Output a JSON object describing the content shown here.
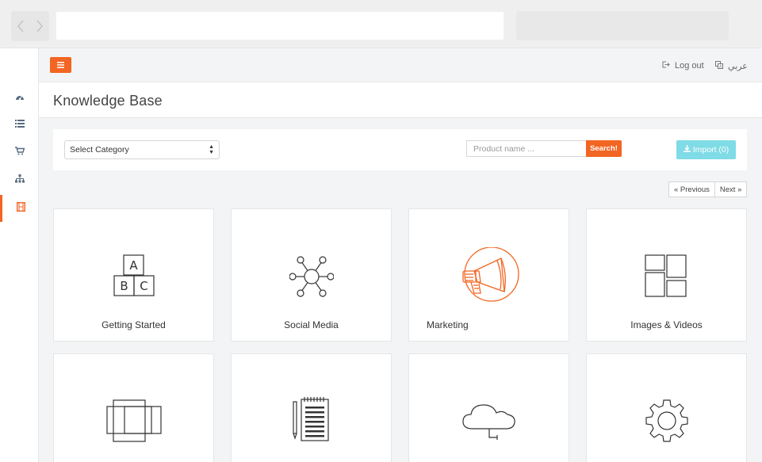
{
  "page": {
    "title": "Knowledge Base"
  },
  "topbar": {
    "logout_label": "Log out",
    "language_label": "عربي"
  },
  "filters": {
    "category_value": "Select Category",
    "search_placeholder": "Product name ...",
    "search_button": "Search!",
    "import_button": "Import (0)"
  },
  "pagination": {
    "previous": "« Previous",
    "next": "Next »"
  },
  "cards": [
    {
      "label": "Getting Started",
      "icon": "abc-blocks-icon"
    },
    {
      "label": "Social Media",
      "icon": "network-icon"
    },
    {
      "label": "Marketing",
      "icon": "megaphone-icon"
    },
    {
      "label": "Images & Videos",
      "icon": "gallery-icon"
    },
    {
      "label": "",
      "icon": "layers-icon"
    },
    {
      "label": "",
      "icon": "notepad-icon"
    },
    {
      "label": "",
      "icon": "cloud-icon"
    },
    {
      "label": "",
      "icon": "gear-icon"
    }
  ],
  "colors": {
    "accent": "#f26522",
    "import_button": "#7fdbe5"
  }
}
